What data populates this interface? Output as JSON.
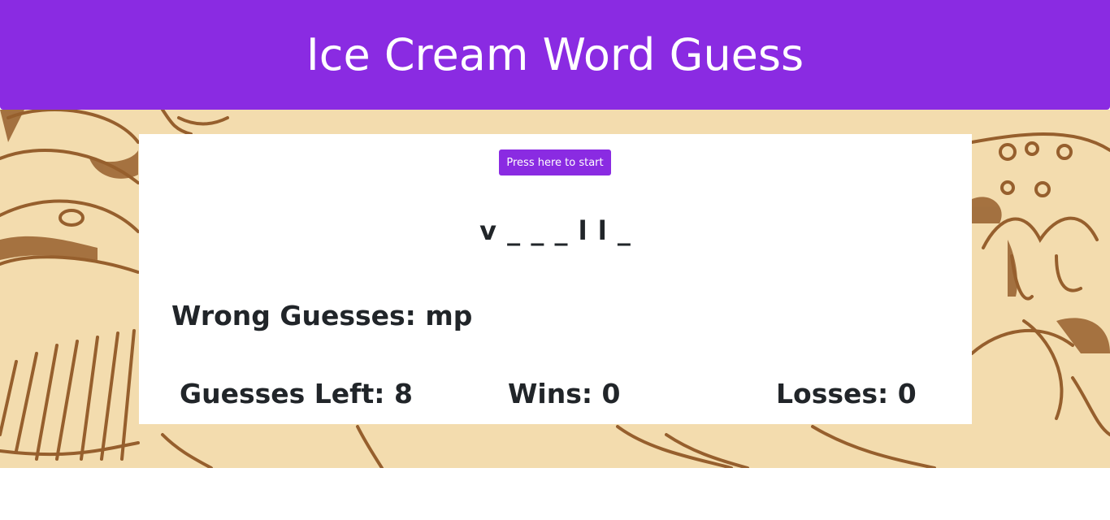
{
  "header": {
    "title": "Ice Cream Word Guess"
  },
  "game": {
    "start_button_label": "Press here to start",
    "word_display": "v _ _ _ l l _",
    "wrong_guesses_label": "Wrong Guesses: mp",
    "guesses_left_label": "Guesses Left: 8",
    "wins_label": "Wins: 0",
    "losses_label": "Losses: 0"
  },
  "colors": {
    "accent": "#8a2be2",
    "background_tan": "#f3dcae",
    "sketch_brown": "#965f2d",
    "card": "#ffffff",
    "text": "#212529"
  }
}
